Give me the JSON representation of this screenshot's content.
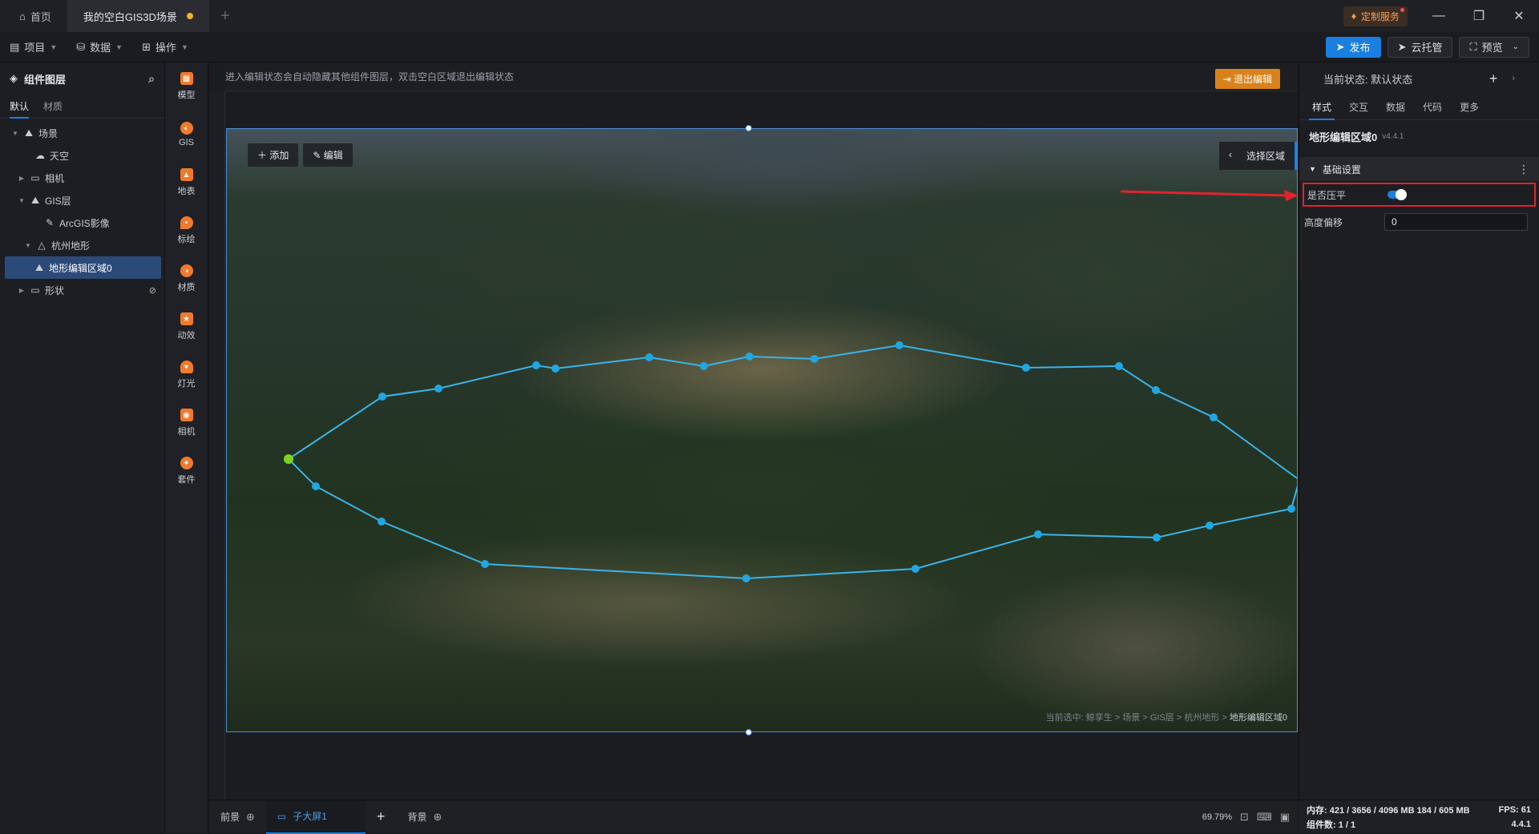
{
  "titlebar": {
    "tabs": [
      {
        "label": "首页"
      },
      {
        "label": "我的空白GIS3D场景"
      }
    ],
    "custom_service": "定制服务"
  },
  "menubar": {
    "menus": [
      "项目",
      "数据",
      "操作"
    ],
    "publish": "发布",
    "cloud": "云托管",
    "preview": "预览"
  },
  "left_panel": {
    "title": "组件图层",
    "tabs": [
      "默认",
      "材质"
    ],
    "tree": [
      {
        "label": "场景"
      },
      {
        "label": "天空"
      },
      {
        "label": "相机"
      },
      {
        "label": "GIS层"
      },
      {
        "label": "ArcGIS影像"
      },
      {
        "label": "杭州地形"
      },
      {
        "label": "地形编辑区域0"
      },
      {
        "label": "形状"
      }
    ]
  },
  "tools": [
    {
      "label": "模型",
      "icon": "model-icon"
    },
    {
      "label": "GIS",
      "icon": "gis-icon"
    },
    {
      "label": "地表",
      "icon": "terrain-icon"
    },
    {
      "label": "标绘",
      "icon": "marker-icon"
    },
    {
      "label": "材质",
      "icon": "material-icon"
    },
    {
      "label": "动效",
      "icon": "effect-icon"
    },
    {
      "label": "灯光",
      "icon": "light-icon"
    },
    {
      "label": "相机",
      "icon": "camera-icon"
    },
    {
      "label": "套件",
      "icon": "kit-icon"
    }
  ],
  "canvas": {
    "hint": "进入编辑状态会自动隐藏其他组件图层，双击空白区域退出编辑状态",
    "exit_edit": "退出编辑",
    "add": "添加",
    "edit": "编辑",
    "select_area": "选择区域",
    "breadcrumb_prefix": "当前选中: 鲸孪生 > 场景 > GIS层 > 杭州地形 > ",
    "breadcrumb_last": "地形编辑区域0"
  },
  "bottombar": {
    "foreground": "前景",
    "active_tab": "子大屏1",
    "background": "背景",
    "zoom": "69.79%"
  },
  "right_panel": {
    "state": "当前状态:  默认状态",
    "tabs": [
      "样式",
      "交互",
      "数据",
      "代码",
      "更多"
    ],
    "component_name": "地形编辑区域0",
    "version": "v4.4.1",
    "section": "基础设置",
    "prop_flatten": "是否压平",
    "flatten_on": true,
    "prop_height_offset": "高度偏移",
    "height_offset_value": "0"
  },
  "statusbar": {
    "memory": "内存:  421 / 3656 / 4096 MB  184 / 605 MB",
    "fps": "FPS:  61",
    "components": "组件数: 1 / 1",
    "version": "4.4.1"
  },
  "colors": {
    "accent": "#1a7fe0",
    "warning": "#d9821c",
    "highlight_red": "#e0242d",
    "polygon": "#3ab4e8"
  }
}
